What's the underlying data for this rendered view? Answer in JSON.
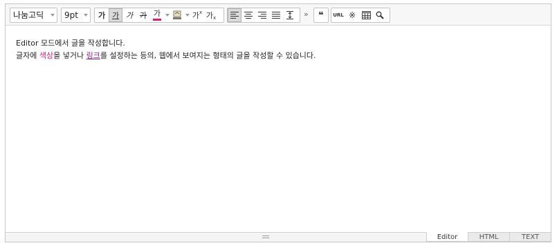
{
  "toolbar": {
    "font_family": "나눔고딕",
    "font_size": "9pt",
    "bold_glyph": "가",
    "underline_glyph": "가",
    "italic_glyph": "가",
    "strike_glyph": "가",
    "font_color_glyph": "가",
    "superscript_glyph": "가",
    "superscript_mark": "x",
    "subscript_glyph": "가",
    "subscript_mark": "x",
    "more_glyph": "»",
    "quote_glyph": "❝",
    "url_label": "URL",
    "special_char_glyph": "※"
  },
  "content": {
    "line1": "Editor 모드에서 글을 작성합니다.",
    "line2_a": "글자에 ",
    "line2_color_word": "색상",
    "line2_b": "을 넣거나 ",
    "line2_link_word": "링크",
    "line2_c": "를 설정하는 등의, 웹에서 보여지는 형태의 글을 작성할 수 있습니다."
  },
  "tabs": [
    "Editor",
    "HTML",
    "TEXT"
  ],
  "colors": {
    "accent_text": "#e0197a",
    "link_text": "#8a1d8f",
    "font_color_bar": "#e0197a"
  }
}
